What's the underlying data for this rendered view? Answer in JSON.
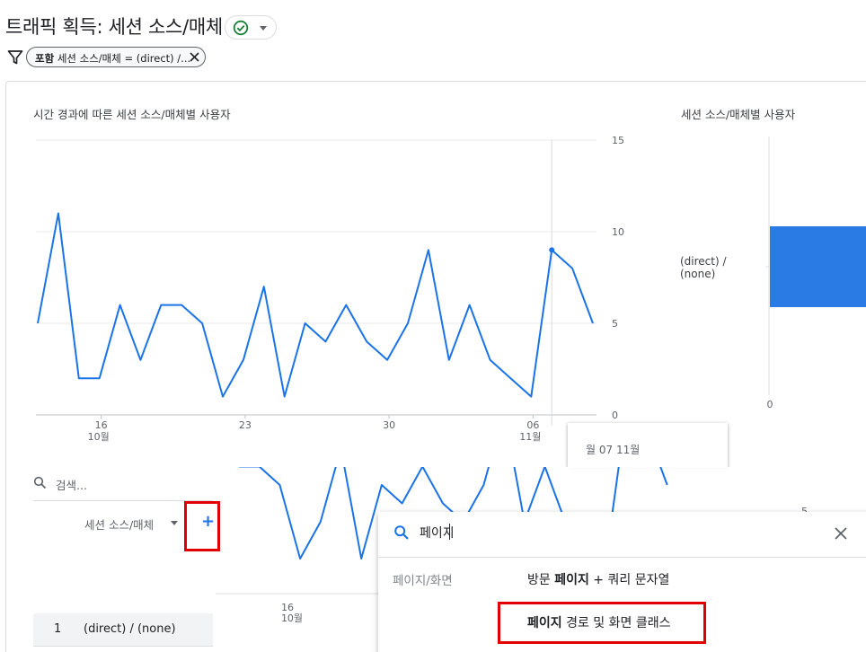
{
  "header": {
    "title": "트래픽 획득: 세션 소스/매체"
  },
  "filter": {
    "prefix": "포함",
    "text": "세션 소스/매체 = (direct) /..."
  },
  "chart_data": [
    {
      "type": "line",
      "title": "시간 경과에 따른 세션 소스/매체별 사용자",
      "x_ticks": [
        {
          "day": "16",
          "month": "10월"
        },
        {
          "day": "23",
          "month": ""
        },
        {
          "day": "30",
          "month": ""
        },
        {
          "day": "06",
          "month": "11월"
        }
      ],
      "y_ticks": [
        "15",
        "10",
        "5",
        "0"
      ],
      "ylim": [
        0,
        15
      ],
      "grid": true,
      "series": [
        {
          "name": "(direct) / (none)",
          "color": "#1a73e8",
          "values": [
            5,
            11,
            2,
            2,
            6,
            3,
            6,
            6,
            5,
            1,
            3,
            7,
            1,
            5,
            4,
            6,
            4,
            3,
            5,
            9,
            3,
            6,
            3,
            2,
            1,
            9,
            8,
            5
          ]
        }
      ]
    },
    {
      "type": "bar",
      "title": "세션 소스/매체별 사용자",
      "categories": [
        "(direct) /\n(none)"
      ],
      "values": [
        10
      ],
      "x_ticks": [
        "0"
      ],
      "color": "#2a7be4"
    }
  ],
  "tooltip": {
    "text": "월 07 11월"
  },
  "table": {
    "search_placeholder": "검색...",
    "dimension_header": "세션 소스/매체",
    "add_dimension": "+",
    "rows": [
      {
        "index": "1",
        "value": "(direct) / (none)"
      }
    ]
  },
  "overlay_chart": {
    "tick_day": "16",
    "tick_month": "10월",
    "y_tick": "5"
  },
  "dropdown": {
    "query": "페이지",
    "group": "페이지/화면",
    "options": [
      {
        "pre": "방문 ",
        "bold": "페이지",
        "post": " + 쿼리 문자열"
      },
      {
        "pre": "",
        "bold": "페이지",
        "post": " 경로 및 화면 클래스"
      }
    ]
  },
  "colors": {
    "accent": "#1a73e8",
    "highlight_border": "#e00000",
    "success": "#188038"
  }
}
